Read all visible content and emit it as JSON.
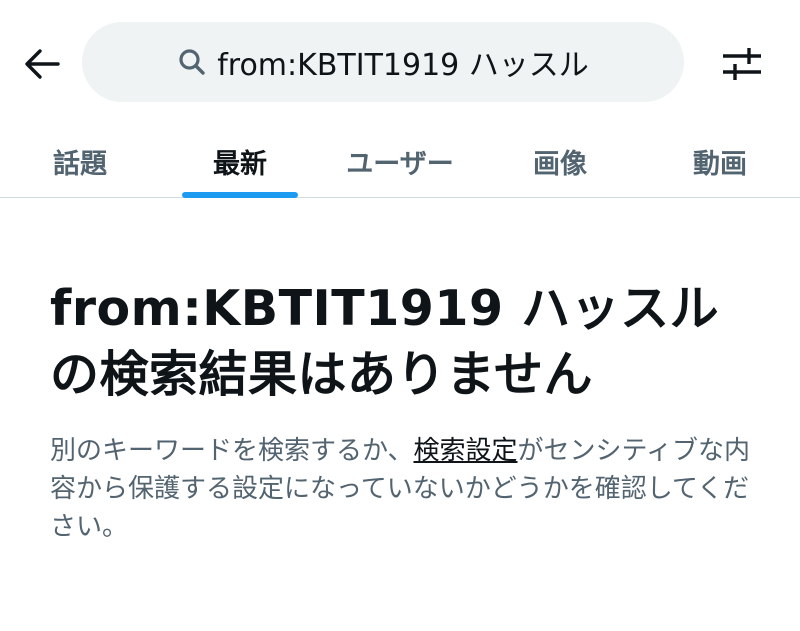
{
  "search": {
    "query": "from:KBTIT1919 ハッスル"
  },
  "icons": {
    "back": "arrow-left-icon",
    "search": "search-icon",
    "filter": "sliders-icon"
  },
  "tabs": [
    {
      "label": "話題"
    },
    {
      "label": "最新"
    },
    {
      "label": "ユーザー"
    },
    {
      "label": "画像"
    },
    {
      "label": "動画"
    }
  ],
  "active_tab": "最新",
  "colors": {
    "accent": "#1d9bf0",
    "search_bg": "#eff3f4",
    "secondary_text": "#536471"
  },
  "empty_state": {
    "title": "from:KBTIT1919 ハッスルの検索結果はありません",
    "desc_before": "別のキーワードを検索するか、",
    "desc_link": "検索設定",
    "desc_after": "がセンシティブな内容から保護する設定になっていないかどうかを確認してください。"
  }
}
